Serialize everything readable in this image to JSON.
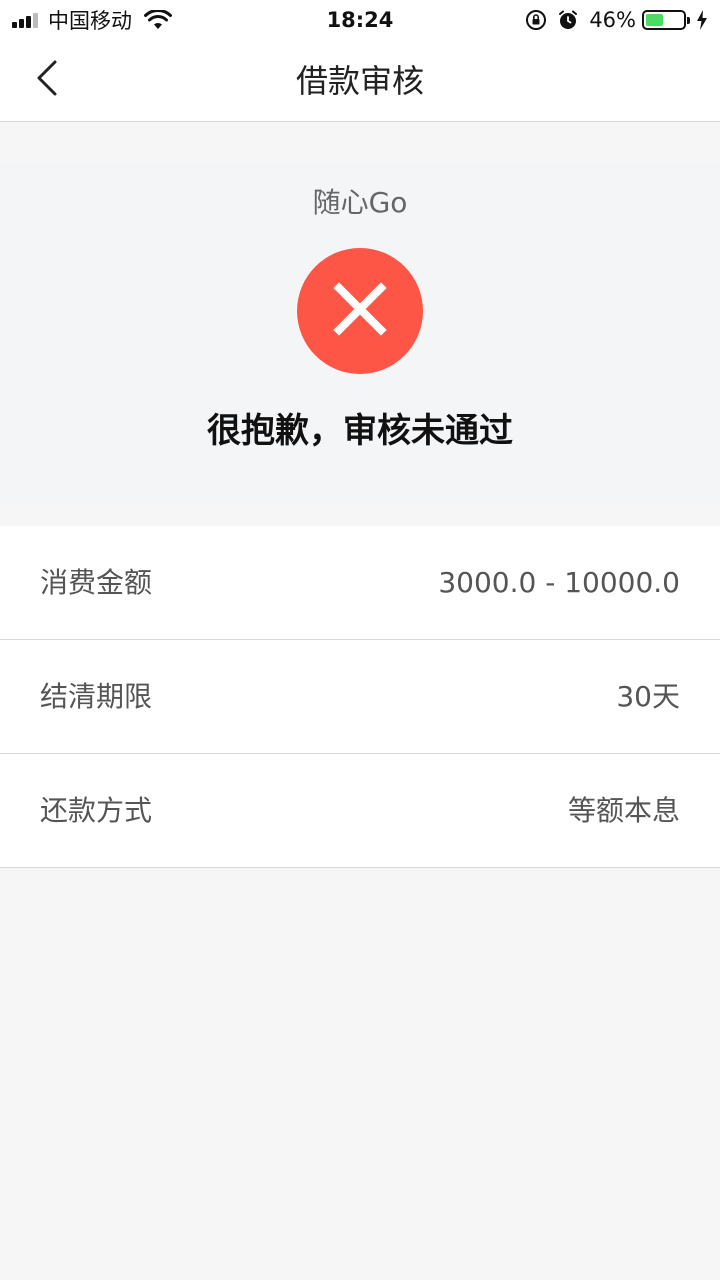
{
  "status_bar": {
    "carrier": "中国移动",
    "time": "18:24",
    "battery_percent": "46%",
    "battery_level": 0.46,
    "icons": [
      "signal-icon",
      "wifi-icon",
      "rotation-lock-icon",
      "alarm-icon",
      "battery-icon",
      "charging-icon"
    ]
  },
  "nav": {
    "title": "借款审核",
    "back_icon": "chevron-left-icon"
  },
  "result": {
    "product_name": "随心Go",
    "status_icon": "close-icon",
    "status_color": "#fd5546",
    "message": "很抱歉，审核未通过"
  },
  "details": [
    {
      "label": "消费金额",
      "value": "3000.0 - 10000.0"
    },
    {
      "label": "结清期限",
      "value": "30天"
    },
    {
      "label": "还款方式",
      "value": "等额本息"
    }
  ]
}
